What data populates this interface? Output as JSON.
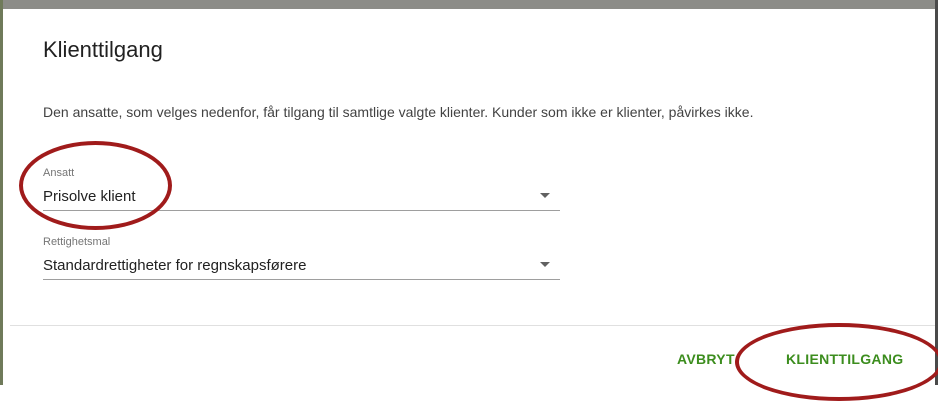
{
  "dialog": {
    "title": "Klienttilgang",
    "description": "Den ansatte, som velges nedenfor, får tilgang til samtlige valgte klienter. Kunder som ikke er klienter, påvirkes ikke.",
    "fields": {
      "ansatt": {
        "label": "Ansatt",
        "value": "Prisolve klient"
      },
      "rettighetsmal": {
        "label": "Rettighetsmal",
        "value": "Standardrettigheter for regnskapsførere"
      }
    },
    "buttons": {
      "cancel": "AVBRYT",
      "confirm": "KLIENTTILGANG"
    }
  },
  "colors": {
    "accent_green": "#3c8d1e",
    "annotation_red": "#a01b1b"
  },
  "icons": {
    "dropdown": "caret-down-icon"
  }
}
